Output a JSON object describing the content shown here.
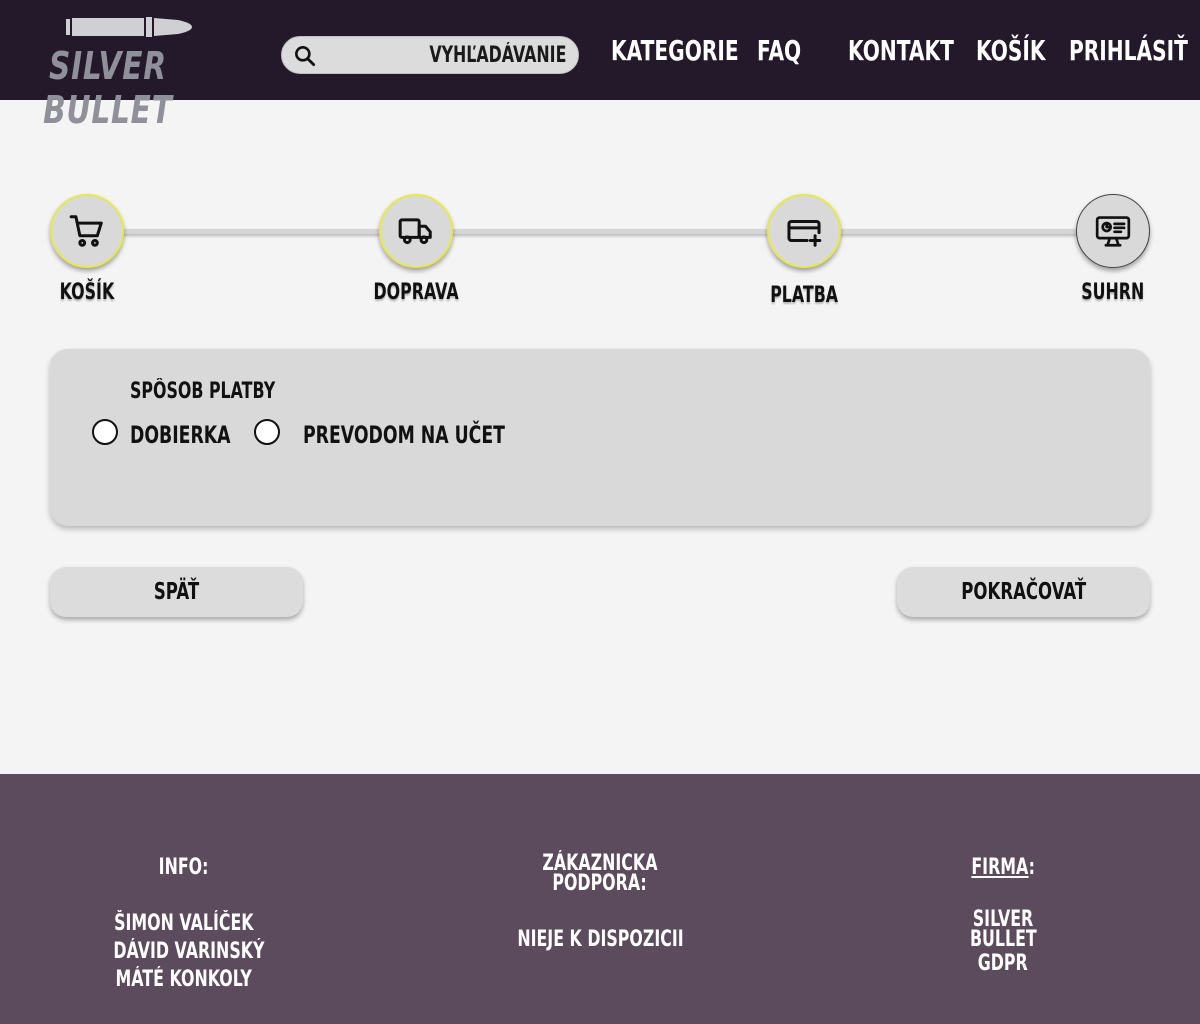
{
  "brand": {
    "name": "SILVER BULLET"
  },
  "search": {
    "placeholder": "VYHĽADÁVANIE"
  },
  "nav": {
    "items": [
      {
        "label": "KATEGORIE"
      },
      {
        "label": "FAQ"
      },
      {
        "label": "KONTAKT"
      },
      {
        "label": "KOŠÍK"
      },
      {
        "label": "PRIHLÁSIŤ"
      }
    ]
  },
  "stepper": {
    "steps": [
      {
        "label": "KOŠÍK",
        "icon": "cart-icon",
        "active": true
      },
      {
        "label": "DOPRAVA",
        "icon": "truck-icon",
        "active": true
      },
      {
        "label": "PLATBA",
        "icon": "credit-card-icon",
        "active": true
      },
      {
        "label": "SUHRN",
        "icon": "monitor-icon",
        "active": false
      }
    ],
    "accent": "#e8e84a"
  },
  "payment": {
    "title": "SPÔSOB PLATBY",
    "options": [
      {
        "label": "DOBIERKA",
        "selected": false
      },
      {
        "label": "PREVODOM NA UČET",
        "selected": false
      }
    ]
  },
  "buttons": {
    "back": "SPÄŤ",
    "continue": "POKRAČOVAŤ"
  },
  "footer": {
    "info": {
      "heading": "INFO:",
      "lines": [
        "ŠIMON VALÍČEK",
        "DÁVID VARINSKÝ",
        "MÁTÉ KONKOLY"
      ]
    },
    "support": {
      "heading_line1": "ZÁKAZNICKA",
      "heading_line2": "PODPORA:",
      "text": "NIEJE K DISPOZICII"
    },
    "company": {
      "heading": "FIRMA",
      "heading_suffix": ":",
      "line1": "SILVER",
      "line2": "BULLET",
      "line3": "GDPR"
    }
  },
  "colors": {
    "header_bg": "#24192a",
    "footer_bg": "#5c4a5d",
    "page_bg": "#f4f4f4"
  }
}
